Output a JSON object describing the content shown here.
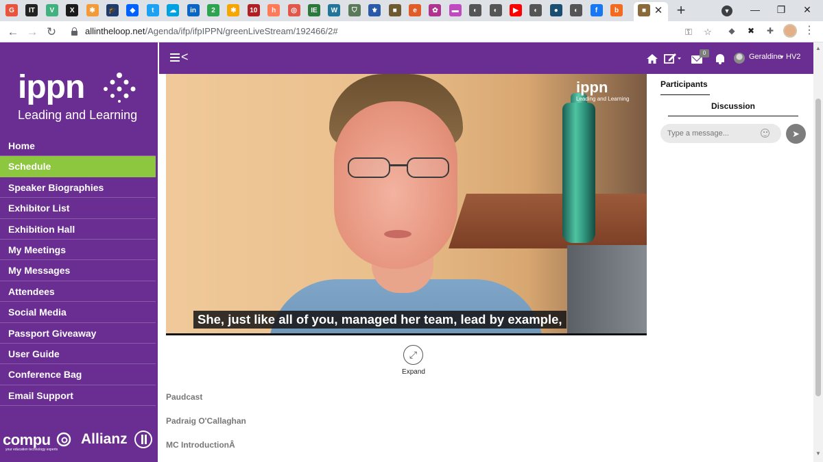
{
  "browser": {
    "url_host": "allintheloop.net",
    "url_path": "/Agenda/ifp/ifpIPPN/greenLiveStream/192466/2#",
    "tab_icons": [
      {
        "name": "grammarly-icon",
        "color": "#e8543d",
        "glyph": "G"
      },
      {
        "name": "it-icon",
        "color": "#222222",
        "glyph": "IT"
      },
      {
        "name": "vue-icon",
        "color": "#3fb27f",
        "glyph": "V"
      },
      {
        "name": "x-icon",
        "color": "#1a1a1a",
        "glyph": "X"
      },
      {
        "name": "joomla-icon",
        "color": "#f29b38",
        "glyph": "✱"
      },
      {
        "name": "graduation-cap-icon",
        "color": "#1f3b6e",
        "glyph": "🎓"
      },
      {
        "name": "dropbox-icon",
        "color": "#0061ff",
        "glyph": "◆"
      },
      {
        "name": "twitter-icon",
        "color": "#1da1f2",
        "glyph": "t"
      },
      {
        "name": "salesforce-icon",
        "color": "#00a1e0",
        "glyph": "☁"
      },
      {
        "name": "linkedin-icon",
        "color": "#0a66c2",
        "glyph": "in"
      },
      {
        "name": "number-2-icon",
        "color": "#2ea44f",
        "glyph": "2"
      },
      {
        "name": "asterisk-icon",
        "color": "#f7a600",
        "glyph": "✱"
      },
      {
        "name": "top10-icon",
        "color": "#b11f24",
        "glyph": "10"
      },
      {
        "name": "hubspot-icon",
        "color": "#ff7a59",
        "glyph": "h"
      },
      {
        "name": "target-icon",
        "color": "#e2574c",
        "glyph": "◎"
      },
      {
        "name": "ie-icon",
        "color": "#2b7a3b",
        "glyph": "IE"
      },
      {
        "name": "wordpress-icon",
        "color": "#21759b",
        "glyph": "W"
      },
      {
        "name": "shield-icon",
        "color": "#5a7a5a",
        "glyph": "⛉"
      },
      {
        "name": "crest-icon",
        "color": "#2a5aa8",
        "glyph": "⚜"
      },
      {
        "name": "cube-icon",
        "color": "#6d5a30",
        "glyph": "■"
      },
      {
        "name": "e-icon",
        "color": "#e05d2a",
        "glyph": "e"
      },
      {
        "name": "flower-icon",
        "color": "#b0338f",
        "glyph": "✿"
      },
      {
        "name": "gradient-icon",
        "color": "#c04ac0",
        "glyph": "▬"
      },
      {
        "name": "globe-icon",
        "color": "#555555",
        "glyph": "◐"
      },
      {
        "name": "globe-icon",
        "color": "#555555",
        "glyph": "◐"
      },
      {
        "name": "youtube-icon",
        "color": "#ff0000",
        "glyph": "▶"
      },
      {
        "name": "globe-icon",
        "color": "#555555",
        "glyph": "◐"
      },
      {
        "name": "circle-icon",
        "color": "#1b4f72",
        "glyph": "●"
      },
      {
        "name": "globe-icon",
        "color": "#555555",
        "glyph": "◐"
      },
      {
        "name": "facebook-icon",
        "color": "#1877f2",
        "glyph": "f"
      },
      {
        "name": "b-icon",
        "color": "#f26b21",
        "glyph": "b"
      }
    ],
    "extensions": [
      {
        "name": "dropbox-ext-icon",
        "glyph": "◆",
        "color": "#5f6368"
      },
      {
        "name": "dark-x-ext-icon",
        "glyph": "✖",
        "color": "#222222"
      },
      {
        "name": "puzzle-icon",
        "glyph": "✚",
        "color": "#5f6368"
      }
    ]
  },
  "topbar": {
    "badge_count": "0",
    "user_name": "Geraldine",
    "user_org": "HV2"
  },
  "sidebar": {
    "logo": {
      "word": "ippn",
      "tagline": "Leading and Learning"
    },
    "menu": [
      {
        "label": "Home",
        "active": false
      },
      {
        "label": "Schedule",
        "active": true
      },
      {
        "label": "Speaker Biographies",
        "active": false
      },
      {
        "label": "Exhibitor List",
        "active": false
      },
      {
        "label": "Exhibition Hall",
        "active": false
      },
      {
        "label": "My Meetings",
        "active": false
      },
      {
        "label": "My Messages",
        "active": false
      },
      {
        "label": "Attendees",
        "active": false
      },
      {
        "label": "Social Media",
        "active": false
      },
      {
        "label": "Passport Giveaway",
        "active": false
      },
      {
        "label": "User Guide",
        "active": false
      },
      {
        "label": "Conference Bag",
        "active": false
      },
      {
        "label": "Email Support",
        "active": false
      }
    ],
    "sponsors": {
      "compu": "compu",
      "compu_tagline": "your education technology experts",
      "allianz": "Allianz"
    }
  },
  "video": {
    "logo_word": "ippn",
    "logo_tagline": "Leading and Learning",
    "caption": "She, just like all of you, managed her team, lead by example,"
  },
  "expand_label": "Expand",
  "sessions": [
    "Paudcast",
    "Padraig O'Callaghan",
    "MC IntroductionÂ"
  ],
  "chat": {
    "tab_participants": "Participants",
    "tab_discussion": "Discussion",
    "input_placeholder": "Type a message..."
  },
  "colors": {
    "brand_purple": "#6a2d91",
    "active_green": "#8dc63f"
  }
}
